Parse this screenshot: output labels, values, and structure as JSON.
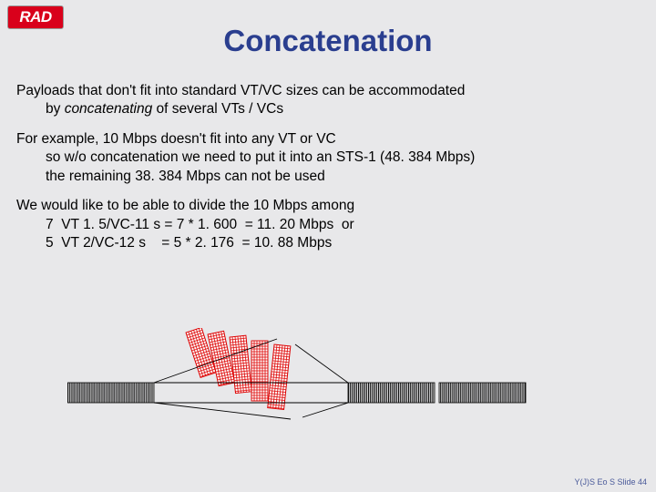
{
  "logo_text": "RAD",
  "title": "Concatenation",
  "p1_a": "Payloads that don't fit into standard VT/VC sizes can be accommodated",
  "p1_b_pre": "by ",
  "p1_b_ital": "concatenating",
  "p1_b_post": " of several VTs / VCs",
  "p2_a": "For example, 10 Mbps doesn't fit into any VT or VC",
  "p2_b": "so w/o concatenation we need to put it into an STS-1 (48. 384 Mbps)",
  "p2_c": "the remaining 38. 384 Mbps can not be used",
  "p3_a": "We would like to be able to divide the 10 Mbps among",
  "p3_b": "7  VT 1. 5/VC-11 s = 7 * 1. 600  = 11. 20 Mbps  or",
  "p3_c": "5  VT 2/VC-12 s    = 5 * 2. 176  = 10. 88 Mbps",
  "footer": "Y(J)S Eo S  Slide 44"
}
